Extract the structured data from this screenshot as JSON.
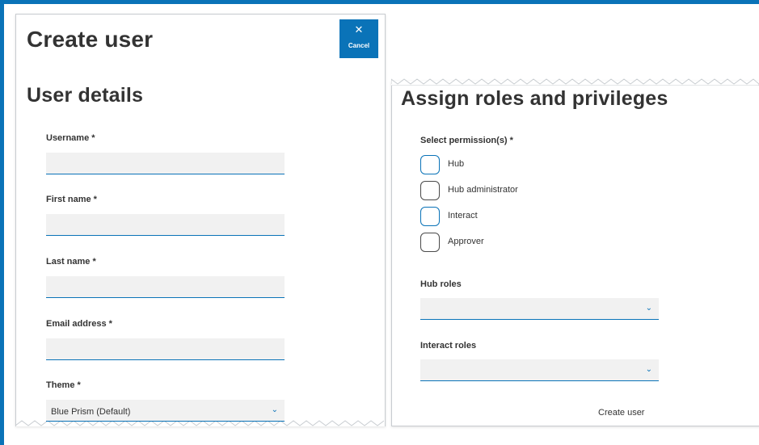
{
  "accent_color": "#0a73b8",
  "left_panel": {
    "title": "Create user",
    "cancel_icon": "close-icon",
    "cancel_label": "Cancel",
    "section_title": "User details",
    "fields": {
      "username": {
        "label": "Username *",
        "value": ""
      },
      "first_name": {
        "label": "First name *",
        "value": ""
      },
      "last_name": {
        "label": "Last name *",
        "value": ""
      },
      "email": {
        "label": "Email address *",
        "value": ""
      },
      "theme": {
        "label": "Theme *",
        "value": "Blue Prism (Default)"
      }
    }
  },
  "right_panel": {
    "title": "Assign roles and privileges",
    "permissions_label": "Select permission(s) *",
    "permissions": [
      {
        "label": "Hub",
        "checked": false
      },
      {
        "label": "Hub administrator",
        "checked": false
      },
      {
        "label": "Interact",
        "checked": false
      },
      {
        "label": "Approver",
        "checked": false
      }
    ],
    "hub_roles_label": "Hub roles",
    "hub_roles_value": "",
    "interact_roles_label": "Interact roles",
    "interact_roles_value": "",
    "create_button": "Create user"
  }
}
